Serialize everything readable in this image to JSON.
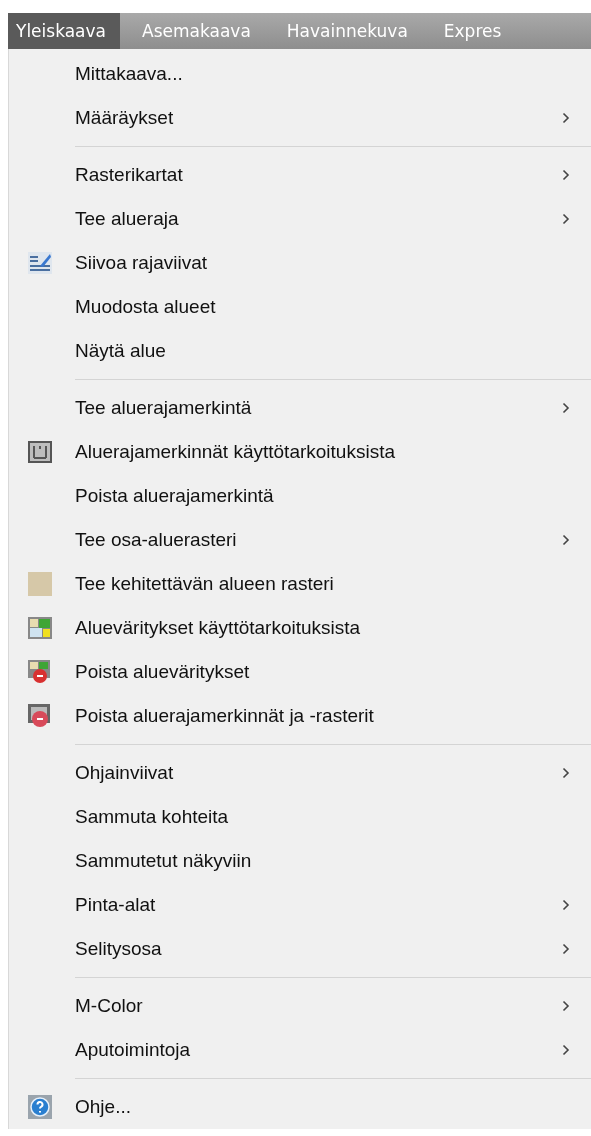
{
  "menubar": [
    {
      "label": "Yleiskaava",
      "selected": true
    },
    {
      "label": "Asemakaava",
      "selected": false
    },
    {
      "label": "Havainnekuva",
      "selected": false
    },
    {
      "label": "Expres",
      "selected": false
    }
  ],
  "menu": {
    "groups": [
      [
        {
          "label": "Mittakaava...",
          "submenu": false,
          "kind": "plain"
        },
        {
          "label": "Määräykset",
          "submenu": true,
          "kind": "plain"
        }
      ],
      [
        {
          "label": "Rasterikartat",
          "submenu": true,
          "kind": "plain"
        },
        {
          "label": "Tee alueraja",
          "submenu": true,
          "kind": "plain"
        },
        {
          "label": "Siivoa rajaviivat",
          "submenu": false,
          "kind": "lines"
        },
        {
          "label": "Muodosta alueet",
          "submenu": false,
          "kind": "plain"
        },
        {
          "label": "Näytä alue",
          "submenu": false,
          "kind": "plain"
        }
      ],
      [
        {
          "label": "Tee aluerajamerkintä",
          "submenu": true,
          "kind": "plain"
        },
        {
          "label": "Aluerajamerkinnät käyttötarkoituksista",
          "submenu": false,
          "kind": "frame"
        },
        {
          "label": "Poista aluerajamerkintä",
          "submenu": false,
          "kind": "plain"
        },
        {
          "label": "Tee osa-aluerasteri",
          "submenu": true,
          "kind": "plain"
        },
        {
          "label": "Tee kehitettävän alueen rasteri",
          "submenu": false,
          "kind": "swatch"
        },
        {
          "label": "Alueväritykset käyttötarkoituksista",
          "submenu": false,
          "kind": "colors"
        },
        {
          "label": "Poista alueväritykset",
          "submenu": false,
          "kind": "erase-colors"
        },
        {
          "label": "Poista aluerajamerkinnät ja -rasterit",
          "submenu": false,
          "kind": "erase-frame"
        }
      ],
      [
        {
          "label": "Ohjainviivat",
          "submenu": true,
          "kind": "plain"
        },
        {
          "label": "Sammuta kohteita",
          "submenu": false,
          "kind": "plain"
        },
        {
          "label": "Sammutetut näkyviin",
          "submenu": false,
          "kind": "plain"
        },
        {
          "label": "Pinta-alat",
          "submenu": true,
          "kind": "plain"
        },
        {
          "label": "Selitysosa",
          "submenu": true,
          "kind": "plain"
        }
      ],
      [
        {
          "label": "M-Color",
          "submenu": true,
          "kind": "plain"
        },
        {
          "label": "Aputoimintoja",
          "submenu": true,
          "kind": "plain"
        }
      ],
      [
        {
          "label": "Ohje...",
          "submenu": false,
          "kind": "help"
        }
      ]
    ]
  }
}
